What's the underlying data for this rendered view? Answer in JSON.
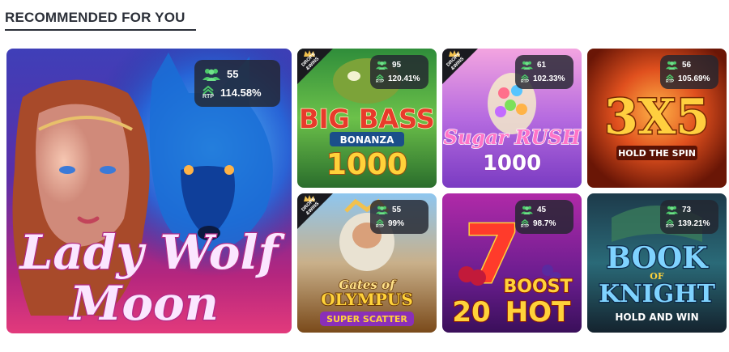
{
  "section": {
    "title": "RECOMMENDED FOR YOU"
  },
  "colors": {
    "badge_bg": "#232630",
    "icon_green": "#4cc96a",
    "title_text": "#2b2f38"
  },
  "icons": {
    "players": "players-icon",
    "rtp": "rtp-up-arrow-icon"
  },
  "games": [
    {
      "title_lines": [
        "Lady Wolf",
        "Moon"
      ],
      "players": "55",
      "rtp_label": "RTP",
      "rtp": "114.58%",
      "drops_wins": false
    },
    {
      "title_lines": [
        "BIG BASS",
        "BONANZA",
        "1000"
      ],
      "players": "95",
      "rtp_label": "RTP",
      "rtp": "120.41%",
      "drops_wins": true,
      "drops_label": [
        "DROPS",
        "&WINS"
      ]
    },
    {
      "title_lines": [
        "Sugar RUSH",
        "1000"
      ],
      "players": "61",
      "rtp_label": "RTP",
      "rtp": "102.33%",
      "drops_wins": true,
      "drops_label": [
        "DROPS",
        "&WINS"
      ]
    },
    {
      "title_lines": [
        "3X5",
        "HOLD THE SPIN"
      ],
      "players": "56",
      "rtp_label": "RTP",
      "rtp": "105.69%",
      "drops_wins": false
    },
    {
      "title_lines": [
        "Gates of",
        "OLYMPUS",
        "SUPER SCATTER"
      ],
      "players": "55",
      "rtp_label": "RTP",
      "rtp": "99%",
      "drops_wins": true,
      "drops_label": [
        "DROPS",
        "&WINS"
      ]
    },
    {
      "title_lines": [
        "7",
        "20",
        "BOOST",
        "HOT"
      ],
      "players": "45",
      "rtp_label": "RTP",
      "rtp": "98.7%",
      "drops_wins": false
    },
    {
      "title_lines": [
        "BOOK",
        "OF",
        "KNIGHT",
        "HOLD AND WIN"
      ],
      "players": "73",
      "rtp_label": "RTP",
      "rtp": "139.21%",
      "drops_wins": false
    }
  ]
}
